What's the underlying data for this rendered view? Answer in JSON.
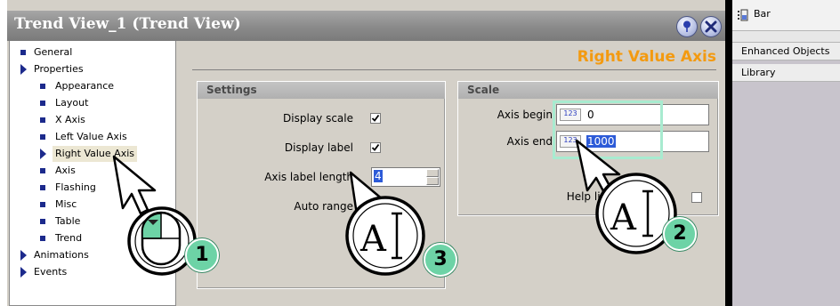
{
  "window": {
    "title": "Trend View_1 (Trend View)",
    "pin_icon": "pin-icon",
    "close_icon": "close-icon"
  },
  "tree": {
    "items": [
      {
        "label": "General",
        "kind": "bullet",
        "level": 0
      },
      {
        "label": "Properties",
        "kind": "expanded",
        "level": 0
      },
      {
        "label": "Appearance",
        "kind": "bullet",
        "level": 1
      },
      {
        "label": "Layout",
        "kind": "bullet",
        "level": 1
      },
      {
        "label": "X Axis",
        "kind": "bullet",
        "level": 1
      },
      {
        "label": "Left Value Axis",
        "kind": "bullet",
        "level": 1
      },
      {
        "label": "Right Value Axis",
        "kind": "selected",
        "level": 1
      },
      {
        "label": "Axis",
        "kind": "bullet",
        "level": 1
      },
      {
        "label": "Flashing",
        "kind": "bullet",
        "level": 1
      },
      {
        "label": "Misc",
        "kind": "bullet",
        "level": 1
      },
      {
        "label": "Table",
        "kind": "bullet",
        "level": 1
      },
      {
        "label": "Trend",
        "kind": "bullet",
        "level": 1
      },
      {
        "label": "Animations",
        "kind": "collapsed",
        "level": 0
      },
      {
        "label": "Events",
        "kind": "collapsed",
        "level": 0
      }
    ]
  },
  "panel": {
    "title": "Right Value Axis",
    "title_color": "#f39a10"
  },
  "settings": {
    "header": "Settings",
    "display_scale": {
      "label": "Display scale",
      "checked": true
    },
    "display_label": {
      "label": "Display label",
      "checked": true
    },
    "axis_label_length": {
      "label": "Axis label length",
      "value": "4"
    },
    "auto_range": {
      "label": "Auto range"
    }
  },
  "scale": {
    "header": "Scale",
    "axis_begin": {
      "label": "Axis begin",
      "type_icon": "123",
      "value": "0"
    },
    "axis_end": {
      "label": "Axis end",
      "type_icon": "123",
      "value": "1000"
    },
    "help_line": {
      "label": "Help line at val",
      "checked": false
    }
  },
  "dock": {
    "bar_label": "Bar",
    "tabs": [
      "Enhanced Objects",
      "Library"
    ]
  },
  "callouts": [
    "1",
    "2",
    "3"
  ],
  "colors": {
    "accent": "#f39a10",
    "badge": "#6dd3a6",
    "highlight_box": "#a8ebd0",
    "selection": "#2d5bd8"
  }
}
